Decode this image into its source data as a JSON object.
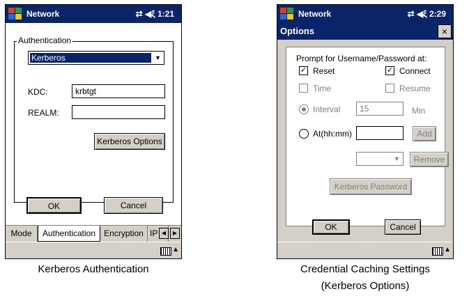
{
  "left_screen": {
    "title": "Network",
    "time": "1:21",
    "group_label": "Authentication",
    "auth_method": "Kerberos",
    "kdc_label": "KDC:",
    "kdc_value": "krbtgt",
    "realm_label": "REALM:",
    "realm_value": "",
    "kerberos_options_label": "Kerberos Options",
    "ok_label": "OK",
    "cancel_label": "Cancel",
    "tabs": [
      "Mode",
      "Authentication",
      "Encryption",
      "IP Co"
    ],
    "caption": "Kerberos Authentication"
  },
  "right_screen": {
    "title": "Network",
    "time": "2:29",
    "dialog_title": "Options",
    "close_glyph": "×",
    "prompt_label": "Prompt for Username/Password at:",
    "reset_label": "Reset",
    "connect_label": "Connect",
    "time_label": "Time",
    "resume_label": "Resume",
    "interval_label": "Interval",
    "interval_value": "15",
    "interval_unit": "Min",
    "at_label": "At(hh:mm)",
    "at_value": "",
    "add_label": "Add",
    "remove_label": "Remove",
    "kerberos_password_label": "Kerberos Password",
    "ok_label": "OK",
    "cancel_label": "Cancel",
    "caption_line1": "Credential Caching Settings",
    "caption_line2": "(Kerberos Options)"
  }
}
